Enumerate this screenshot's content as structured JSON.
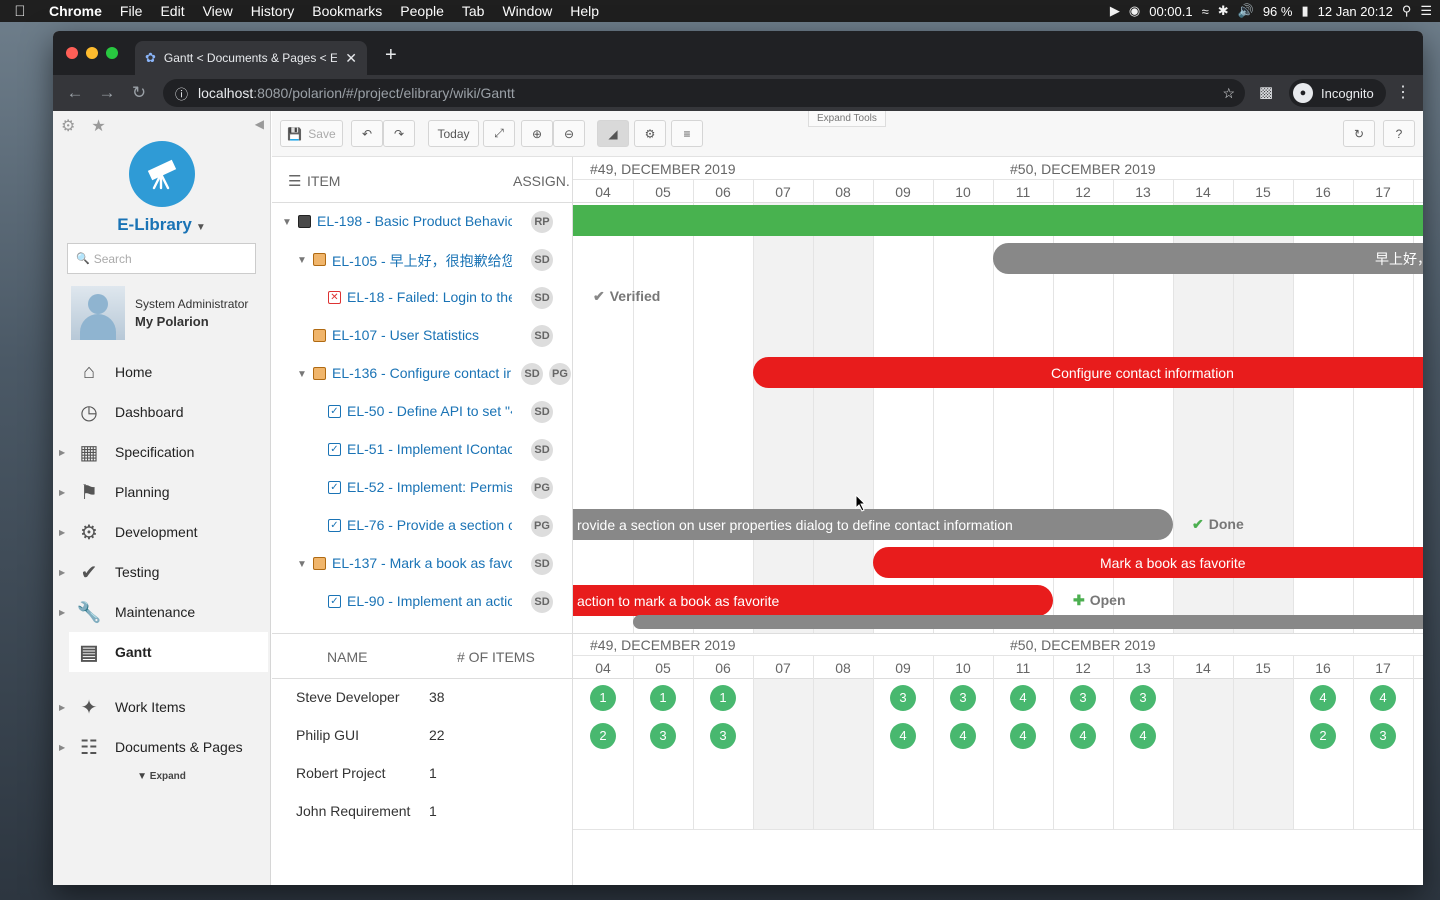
{
  "menubar": {
    "app": "Chrome",
    "items": [
      "File",
      "Edit",
      "View",
      "History",
      "Bookmarks",
      "People",
      "Tab",
      "Window",
      "Help"
    ],
    "recording_time": "00:00.1",
    "battery": "96 %",
    "datetime": "12 Jan  20:12"
  },
  "browser": {
    "tab_title": "Gantt < Documents & Pages < E",
    "url_host": "localhost",
    "url_rest": ":8080/polarion/#/project/elibrary/wiki/Gantt",
    "profile": "Incognito"
  },
  "sidebar": {
    "project": "E-Library",
    "search_placeholder": "Search",
    "user_name": "System Administrator",
    "user_link": "My Polarion",
    "nav": [
      {
        "label": "Home",
        "icon": "home-icon"
      },
      {
        "label": "Dashboard",
        "icon": "dashboard-icon"
      },
      {
        "label": "Specification",
        "icon": "specification-icon"
      },
      {
        "label": "Planning",
        "icon": "planning-icon"
      },
      {
        "label": "Development",
        "icon": "development-icon"
      },
      {
        "label": "Testing",
        "icon": "testing-icon"
      },
      {
        "label": "Maintenance",
        "icon": "maintenance-icon"
      },
      {
        "label": "Gantt",
        "icon": "gantt-icon"
      },
      {
        "label": "Work Items",
        "icon": "work-items-icon"
      },
      {
        "label": "Documents & Pages",
        "icon": "documents-icon"
      }
    ],
    "expand": "Expand"
  },
  "toolbar": {
    "save": "Save",
    "today": "Today",
    "expand_tools": "Expand Tools"
  },
  "gantt": {
    "col_item": "ITEM",
    "col_assign": "ASSIGN.",
    "week1": "#49, DECEMBER 2019",
    "week2": "#50, DECEMBER 2019",
    "days": [
      "04",
      "05",
      "06",
      "07",
      "08",
      "09",
      "10",
      "11",
      "12",
      "13",
      "14",
      "15",
      "16",
      "17"
    ],
    "rows": [
      {
        "label": "EL-198 - Basic Product Behavic",
        "assignees": [
          "RP"
        ]
      },
      {
        "label": "EL-105 - 早上好，很抱歉给您",
        "assignees": [
          "SD"
        ]
      },
      {
        "label": "EL-18 - Failed: Login to the",
        "assignees": [
          "SD"
        ]
      },
      {
        "label": "EL-107 - User Statistics",
        "assignees": [
          "SD"
        ]
      },
      {
        "label": "EL-136 - Configure contact ir",
        "assignees": [
          "SD",
          "PG"
        ]
      },
      {
        "label": "EL-50 - Define API to set \"‹",
        "assignees": [
          "SD"
        ]
      },
      {
        "label": "EL-51 - Implement IContac",
        "assignees": [
          "SD"
        ]
      },
      {
        "label": "EL-52 - Implement: Permis",
        "assignees": [
          "PG"
        ]
      },
      {
        "label": "EL-76 - Provide a section c",
        "assignees": [
          "PG"
        ]
      },
      {
        "label": "EL-137 - Mark a book as favc",
        "assignees": [
          "SD"
        ]
      },
      {
        "label": "EL-90 - Implement an actic",
        "assignees": [
          "SD"
        ]
      }
    ],
    "bars": {
      "el105": "早上好，",
      "el136": "Configure contact information",
      "el76": "rovide a section on user properties dialog to define contact information",
      "el137": "Mark a book as favorite",
      "el90": "action to mark a book as favorite"
    },
    "status": {
      "verified": "Verified",
      "done": "Done",
      "open": "Open"
    }
  },
  "resources": {
    "col_name": "NAME",
    "col_items": "# OF ITEMS",
    "people": [
      {
        "name": "Steve Developer",
        "items": "38"
      },
      {
        "name": "Philip GUI",
        "items": "22"
      },
      {
        "name": "Robert Project",
        "items": "1"
      },
      {
        "name": "John Requirement",
        "items": "1"
      }
    ],
    "steve_load": [
      "1",
      "1",
      "1",
      "",
      "",
      "3",
      "3",
      "4",
      "3",
      "3",
      "",
      "",
      "4",
      "4"
    ],
    "philip_load": [
      "2",
      "3",
      "3",
      "",
      "",
      "4",
      "4",
      "4",
      "4",
      "4",
      "",
      "",
      "2",
      "3"
    ]
  }
}
